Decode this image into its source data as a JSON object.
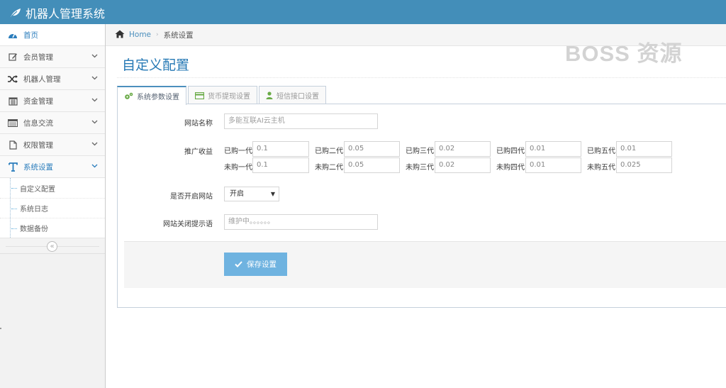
{
  "app": {
    "title": "机器人管理系统"
  },
  "sidebar": {
    "items": [
      {
        "label": "首页",
        "icon": "tachometer-icon"
      },
      {
        "label": "会员管理",
        "icon": "edit-icon"
      },
      {
        "label": "机器人管理",
        "icon": "random-icon"
      },
      {
        "label": "资金管理",
        "icon": "calendar-icon"
      },
      {
        "label": "信息交流",
        "icon": "list-icon"
      },
      {
        "label": "权限管理",
        "icon": "file-icon"
      },
      {
        "label": "系统设置",
        "icon": "text-icon"
      }
    ],
    "subitems": [
      "自定义配置",
      "系统日志",
      "数据备份"
    ],
    "collapse_glyph": "«"
  },
  "breadcrumb": {
    "home": "Home",
    "current": "系统设置"
  },
  "watermark": "BOSS 资源",
  "page": {
    "title": "自定义配置"
  },
  "tabs": [
    {
      "label": "系统参数设置",
      "icon": "cogs-icon",
      "active": true
    },
    {
      "label": "货币提现设置",
      "icon": "credit-card-icon",
      "active": false
    },
    {
      "label": "短信接口设置",
      "icon": "user-icon",
      "active": false
    }
  ],
  "form": {
    "site_name": {
      "label": "网站名称",
      "placeholder": "多能互联AI云主机"
    },
    "promo": {
      "label": "推广收益",
      "bought": [
        {
          "label": "已购一代",
          "value": "0.1"
        },
        {
          "label": "已购二代",
          "value": "0.05"
        },
        {
          "label": "已购三代",
          "value": "0.02"
        },
        {
          "label": "已购四代",
          "value": "0.01"
        },
        {
          "label": "已购五代",
          "value": "0.01"
        }
      ],
      "unbought": [
        {
          "label": "未购一代",
          "value": "0.1"
        },
        {
          "label": "未购二代",
          "value": "0.05"
        },
        {
          "label": "未购三代",
          "value": "0.02"
        },
        {
          "label": "未购四代",
          "value": "0.01"
        },
        {
          "label": "未购五代",
          "value": "0.025"
        }
      ]
    },
    "site_open": {
      "label": "是否开启网站",
      "value": "开启"
    },
    "close_msg": {
      "label": "网站关闭提示语",
      "placeholder": "维护中。。。。。。"
    },
    "save_label": "保存设置"
  },
  "colors": {
    "navbar": "#438eb9",
    "accent": "#2679b5",
    "button": "#6fb3e0"
  }
}
